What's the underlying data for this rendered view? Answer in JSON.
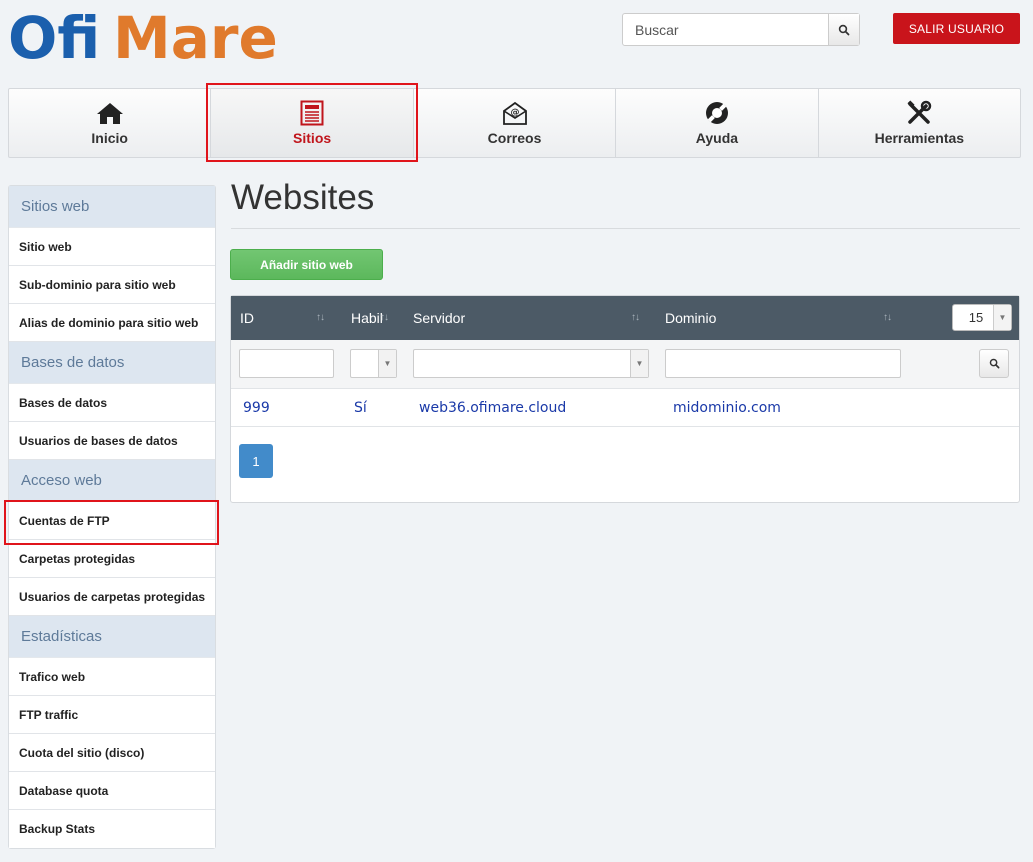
{
  "brand": {
    "part1": "Ofi",
    "part2": "Mare"
  },
  "header": {
    "search_placeholder": "Buscar",
    "logout_label": "SALIR USUARIO",
    "colors": {
      "logout_bg": "#c9141b",
      "logo_blue": "#1b5fad",
      "logo_orange": "#e07a2c"
    }
  },
  "nav": {
    "items": [
      {
        "label": "Inicio",
        "icon": "home-icon"
      },
      {
        "label": "Sitios",
        "icon": "newspaper-icon",
        "active": true
      },
      {
        "label": "Correos",
        "icon": "envelope-icon"
      },
      {
        "label": "Ayuda",
        "icon": "lifebuoy-icon"
      },
      {
        "label": "Herramientas",
        "icon": "tools-icon"
      }
    ]
  },
  "sidebar": {
    "sections": [
      {
        "title": "Sitios web",
        "items": [
          "Sitio web",
          "Sub-dominio para sitio web",
          "Alias de dominio para sitio web"
        ]
      },
      {
        "title": "Bases de datos",
        "items": [
          "Bases de datos",
          "Usuarios de bases de datos"
        ]
      },
      {
        "title": "Acceso web",
        "items": [
          "Cuentas de FTP",
          "Carpetas protegidas",
          "Usuarios de carpetas protegidas"
        ]
      },
      {
        "title": "Estadísticas",
        "items": [
          "Trafico web",
          "FTP traffic",
          "Cuota del sitio (disco)",
          "Database quota",
          "Backup Stats"
        ]
      }
    ]
  },
  "main": {
    "title": "Websites",
    "add_button": "Añadir sitio web",
    "table": {
      "columns": [
        "ID",
        "Habil",
        "Servidor",
        "Dominio"
      ],
      "page_size": "15",
      "rows": [
        {
          "id": "999",
          "enabled": "Sí",
          "server": "web36.ofimare.cloud",
          "domain": "midominio.com"
        }
      ]
    },
    "pagination": {
      "current": "1"
    }
  }
}
